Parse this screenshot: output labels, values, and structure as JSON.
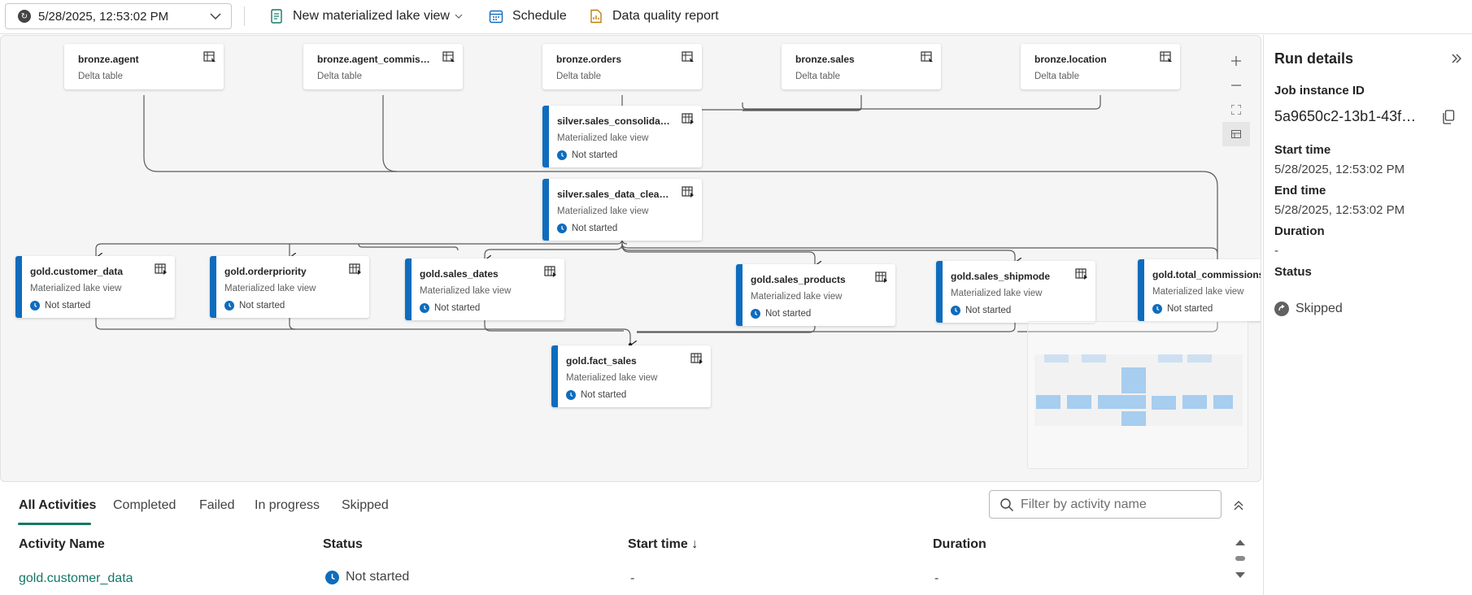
{
  "toolbar": {
    "run_selector": "5/28/2025, 12:53:02 PM",
    "new_view_label": "New materialized lake view",
    "schedule_label": "Schedule",
    "data_quality_label": "Data quality report"
  },
  "graph": {
    "nodes": {
      "bronze_agent": {
        "title": "bronze.agent",
        "subtitle": "Delta table"
      },
      "bronze_agent_commission": {
        "title": "bronze.agent_commissio...",
        "subtitle": "Delta table"
      },
      "bronze_orders": {
        "title": "bronze.orders",
        "subtitle": "Delta table"
      },
      "bronze_sales": {
        "title": "bronze.sales",
        "subtitle": "Delta table"
      },
      "bronze_location": {
        "title": "bronze.location",
        "subtitle": "Delta table"
      },
      "silver_sales_consolidated": {
        "title": "silver.sales_consolidated",
        "subtitle": "Materialized lake view",
        "status": "Not started"
      },
      "silver_sales_data_cleaned": {
        "title": "silver.sales_data_cleaned",
        "subtitle": "Materialized lake view",
        "status": "Not started"
      },
      "gold_customer_data": {
        "title": "gold.customer_data",
        "subtitle": "Materialized lake view",
        "status": "Not started"
      },
      "gold_orderpriority": {
        "title": "gold.orderpriority",
        "subtitle": "Materialized lake view",
        "status": "Not started"
      },
      "gold_sales_dates": {
        "title": "gold.sales_dates",
        "subtitle": "Materialized lake view",
        "status": "Not started"
      },
      "gold_sales_products": {
        "title": "gold.sales_products",
        "subtitle": "Materialized lake view",
        "status": "Not started"
      },
      "gold_sales_shipmode": {
        "title": "gold.sales_shipmode",
        "subtitle": "Materialized lake view",
        "status": "Not started"
      },
      "gold_total_commissions": {
        "title": "gold.total_commissions",
        "subtitle": "Materialized lake view",
        "status": "Not started"
      },
      "gold_fact_sales": {
        "title": "gold.fact_sales",
        "subtitle": "Materialized lake view",
        "status": "Not started"
      }
    }
  },
  "run_details": {
    "title": "Run details",
    "job_id_label": "Job instance ID",
    "job_id": "5a9650c2-13b1-43f6...",
    "start_label": "Start time",
    "start_value": "5/28/2025, 12:53:02 PM",
    "end_label": "End time",
    "end_value": "5/28/2025, 12:53:02 PM",
    "duration_label": "Duration",
    "duration_value": "-",
    "status_label": "Status",
    "status_value": "Skipped"
  },
  "activities": {
    "tabs": [
      "All Activities",
      "Completed",
      "Failed",
      "In progress",
      "Skipped"
    ],
    "filter_placeholder": "Filter by activity name",
    "columns": {
      "name": "Activity Name",
      "status": "Status",
      "start": "Start time ↓",
      "duration": "Duration"
    },
    "rows": [
      {
        "name": "gold.customer_data",
        "status": "Not started",
        "start": "-",
        "duration": "-"
      }
    ]
  },
  "colors": {
    "accent_blue": "#0f6cbd",
    "teal": "#117865"
  }
}
